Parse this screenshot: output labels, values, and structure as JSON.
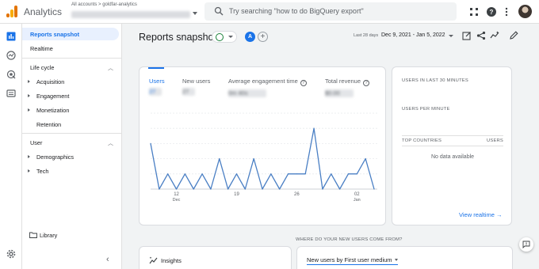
{
  "app": {
    "title": "Analytics"
  },
  "account": {
    "breadcrumb": "All accounts > goldfar-analytics",
    "property_name": "goldfar - Marketing Pages"
  },
  "search": {
    "placeholder": "Try searching \"how to do BigQuery export\""
  },
  "header_icons": [
    "apps-icon",
    "help-icon",
    "more-vert-icon",
    "account-avatar"
  ],
  "rail_icons": [
    "reports-icon",
    "explore-icon",
    "advertising-icon",
    "configure-icon",
    "settings-icon"
  ],
  "nav": {
    "reports_snapshot": "Reports snapshot",
    "realtime": "Realtime",
    "life_cycle": {
      "label": "Life cycle",
      "items": [
        "Acquisition",
        "Engagement",
        "Monetization",
        "Retention"
      ]
    },
    "user": {
      "label": "User",
      "items": [
        "Demographics",
        "Tech"
      ]
    },
    "library": "Library",
    "collapse": "‹"
  },
  "page": {
    "title": "Reports snapshot",
    "segment": "A",
    "add_segment": "+",
    "date_label": "Last 28 days",
    "date_range": "Dec 9, 2021 - Jan 5, 2022"
  },
  "metrics": [
    {
      "label": "Users",
      "value": "27",
      "active": true
    },
    {
      "label": "New users",
      "value": "27",
      "active": false
    },
    {
      "label": "Average engagement time",
      "value": "0m 40s",
      "active": false,
      "help": "?"
    },
    {
      "label": "Total revenue",
      "value": "$0.00",
      "active": false,
      "help": "?"
    }
  ],
  "chart_data": {
    "type": "line",
    "title": "",
    "x_ticks": [
      {
        "day": "12",
        "month": "Dec"
      },
      {
        "day": "19",
        "month": ""
      },
      {
        "day": "26",
        "month": ""
      },
      {
        "day": "02",
        "month": "Jan"
      }
    ],
    "series": [
      {
        "values": [
          3,
          0,
          1,
          0,
          1,
          0,
          1,
          0,
          2,
          0,
          1,
          0,
          2,
          0,
          1,
          0,
          1,
          1,
          1,
          4,
          0,
          1,
          0,
          1,
          1,
          2,
          0
        ]
      }
    ],
    "ylim": [
      0,
      5
    ],
    "color": "#4a7fc4"
  },
  "realtime": {
    "users_in_last_30": "USERS IN LAST 30 MINUTES",
    "users_per_minute": "USERS PER MINUTE",
    "top_countries": "TOP COUNTRIES",
    "users_col": "USERS",
    "no_data": "No data available",
    "view_realtime": "View realtime →"
  },
  "new_users_section": {
    "heading": "WHERE DO YOUR NEW USERS COME FROM?",
    "select": "New users by First user medium"
  },
  "insights": {
    "label": "Insights"
  },
  "colors": {
    "accent": "#1a73e8",
    "line": "#4a7fc4",
    "ok": "#188038"
  }
}
